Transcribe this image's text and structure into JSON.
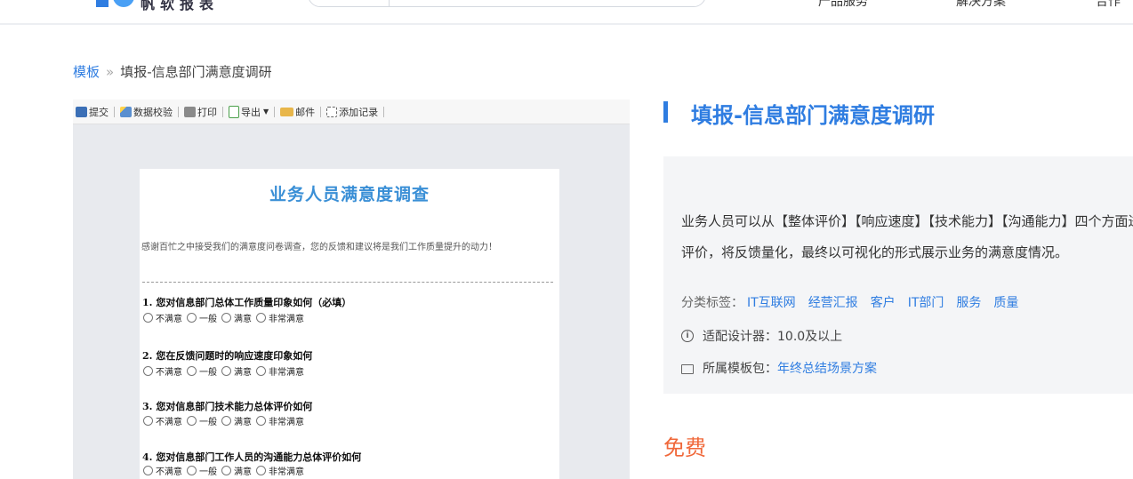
{
  "header": {
    "logo_text": "帆软报表",
    "nav": [
      "产品服务",
      "解决方案",
      "合作"
    ]
  },
  "breadcrumb": {
    "root": "模板",
    "separator": "»",
    "current": "填报-信息部门满意度调研"
  },
  "preview": {
    "toolbar": [
      {
        "label": "提交",
        "icon": "save-icon",
        "color": "#3b6fb6"
      },
      {
        "label": "数据校验",
        "icon": "check-wand-icon",
        "color": "#5a8fd0"
      },
      {
        "label": "打印",
        "icon": "printer-icon",
        "color": "#777777"
      },
      {
        "label": "导出",
        "icon": "export-icon",
        "color": "#4aa04a"
      },
      {
        "label": "邮件",
        "icon": "mail-icon",
        "color": "#e8b64a"
      },
      {
        "label": "添加记录",
        "icon": "add-record-icon",
        "color": "#666666"
      }
    ],
    "form": {
      "title": "业务人员满意度调查",
      "intro": "感谢百忙之中接受我们的满意度问卷调查，您的反馈和建议将是我们工作质量提升的动力！",
      "questions": [
        {
          "text": "1.  您对信息部门总体工作质量印象如何（必填）",
          "options": [
            "不满意",
            "一般",
            "满意",
            "非常满意"
          ]
        },
        {
          "text": "2.  您在反馈问题时的响应速度印象如何",
          "options": [
            "不满意",
            "一般",
            "满意",
            "非常满意"
          ]
        },
        {
          "text": "3.  您对信息部门技术能力总体评价如何",
          "options": [
            "不满意",
            "一般",
            "满意",
            "非常满意"
          ]
        },
        {
          "text": "4.  您对信息部门工作人员的沟通能力总体评价如何",
          "options": [
            "不满意",
            "一般",
            "满意",
            "非常满意"
          ]
        }
      ]
    }
  },
  "details": {
    "title": "填报-信息部门满意度调研",
    "description": "业务人员可以从【整体评价】【响应速度】【技术能力】【沟通能力】四个方面进行评价，将反馈量化，最终以可视化的形式展示业务的满意度情况。",
    "tags_label": "分类标签：",
    "tags": [
      "IT互联网",
      "经营汇报",
      "客户",
      "IT部门",
      "服务",
      "质量"
    ],
    "designer_label": "适配设计器：10.0及以上",
    "package_label": "所属模板包：",
    "package_link": "年终总结场景方案",
    "price": "免费",
    "accent_color": "#2f7de1",
    "price_color": "#f0683a"
  }
}
